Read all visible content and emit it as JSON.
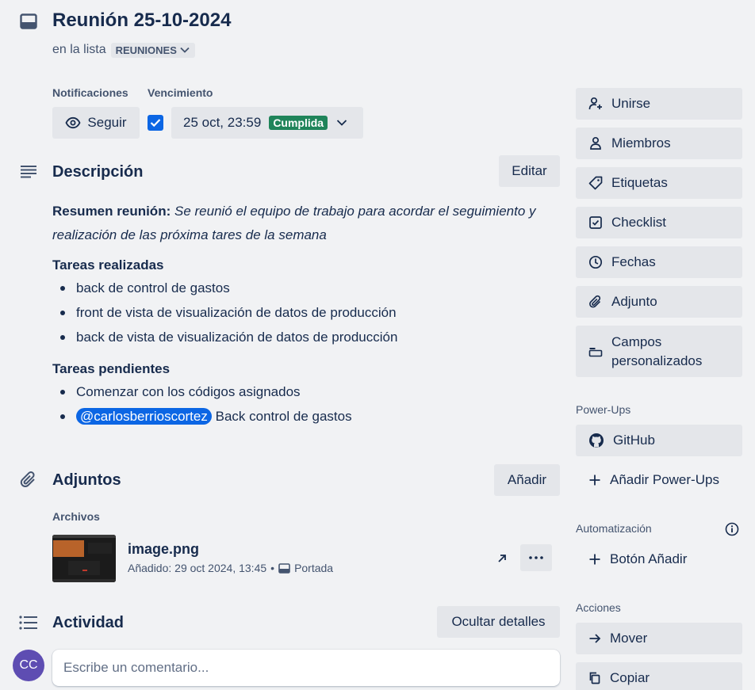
{
  "card": {
    "title": "Reunión 25-10-2024",
    "in_list_prefix": "en la lista",
    "list_name": "REUNIONES"
  },
  "notifications": {
    "label": "Notificaciones",
    "follow_button": "Seguir"
  },
  "due": {
    "label": "Vencimiento",
    "checked": true,
    "date": "25 oct, 23:59",
    "status": "Cumplida",
    "status_color": "#1f845a"
  },
  "description": {
    "title": "Descripción",
    "edit_button": "Editar",
    "summary_label": "Resumen reunión:",
    "summary_text": "Se reunió el equipo de trabajo para acordar el seguimiento y realización de las próxima tares de la semana",
    "done_heading": "Tareas realizadas",
    "done_items": [
      "back de control de gastos",
      "front de vista de visualización de datos de producción",
      "back de vista de visualización de datos de producción"
    ],
    "pending_heading": "Tareas pendientes",
    "pending_item_1": "Comenzar con los códigos asignados",
    "pending_mention": "@carlosberrioscortez",
    "pending_item_2": "Back control de gastos"
  },
  "attachments": {
    "title": "Adjuntos",
    "add_button": "Añadir",
    "files_label": "Archivos",
    "file": {
      "name": "image.png",
      "added": "Añadido: 29 oct 2024, 13:45",
      "separator": "•",
      "cover_label": "Portada"
    }
  },
  "activity": {
    "title": "Actividad",
    "hide_button": "Ocultar detalles",
    "avatar_initials": "CC",
    "avatar_color": "#5e4db2",
    "comment_placeholder": "Escribe un comentario..."
  },
  "sidebar": {
    "add_to_card": [
      {
        "label": "Unirse",
        "icon": "add-person-icon"
      },
      {
        "label": "Miembros",
        "icon": "person-icon"
      },
      {
        "label": "Etiquetas",
        "icon": "tag-icon"
      },
      {
        "label": "Checklist",
        "icon": "checklist-icon"
      },
      {
        "label": "Fechas",
        "icon": "clock-icon"
      },
      {
        "label": "Adjunto",
        "icon": "paperclip-icon"
      },
      {
        "label": "Campos personalizados",
        "icon": "custom-fields-icon"
      }
    ],
    "powerups_label": "Power-Ups",
    "github": "GitHub",
    "add_powerups": "Añadir Power-Ups",
    "automation_label": "Automatización",
    "add_button_label": "Botón Añadir",
    "actions_label": "Acciones",
    "move": "Mover",
    "copy": "Copiar"
  },
  "colors": {
    "accent": "#0c66e4",
    "background": "#f1f2f4",
    "button": "#e4e6ea"
  }
}
